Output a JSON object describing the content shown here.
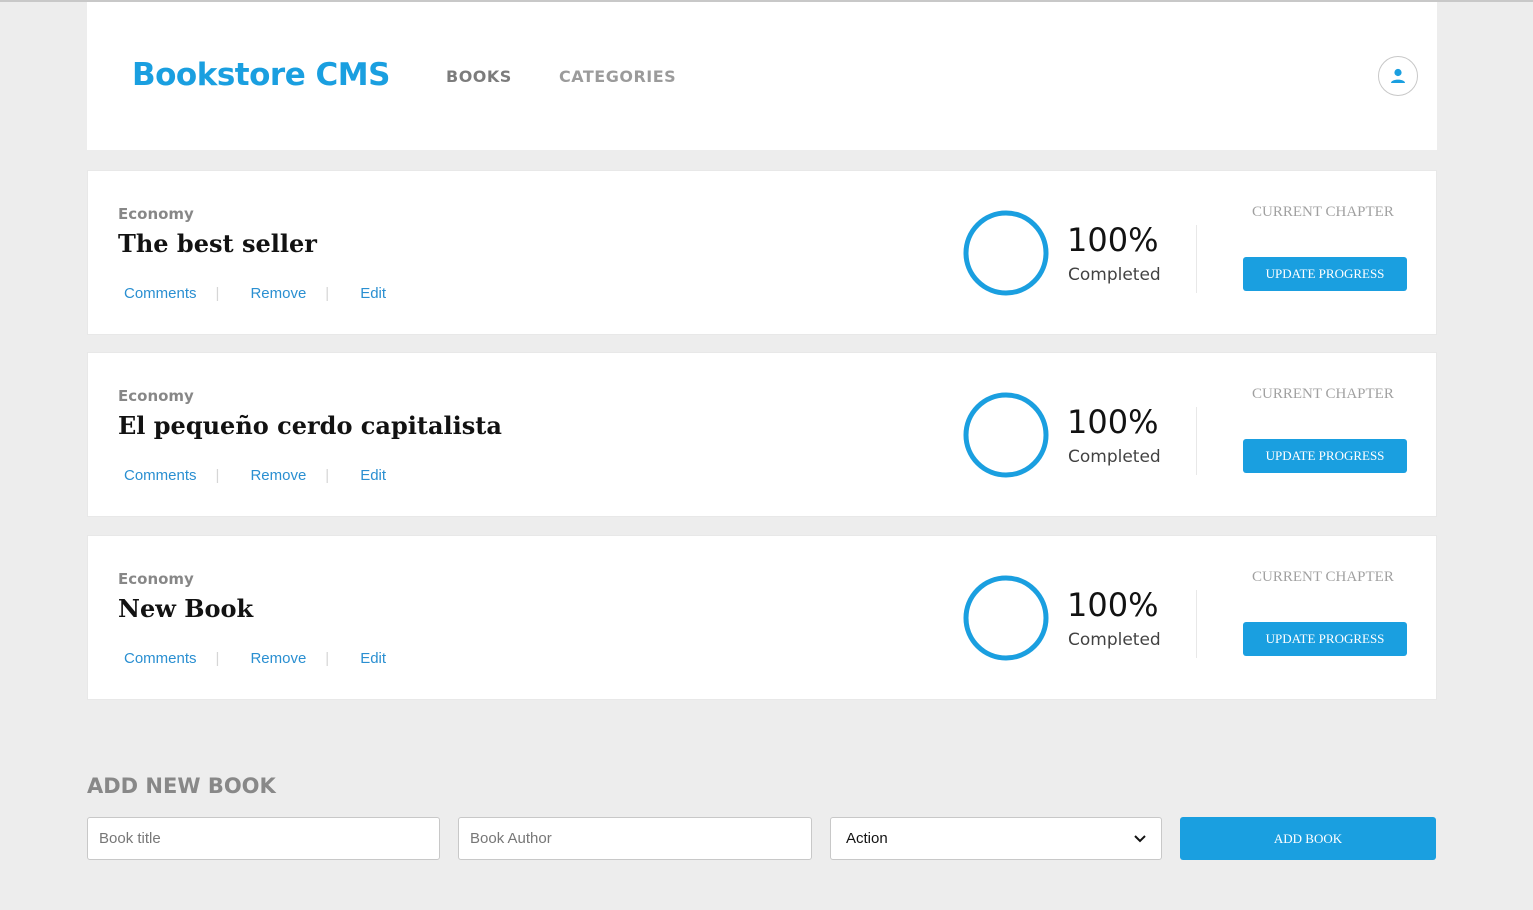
{
  "header": {
    "brand": "Bookstore CMS",
    "nav": [
      {
        "label": "BOOKS"
      },
      {
        "label": "CATEGORIES"
      }
    ],
    "avatar_icon": "user-icon"
  },
  "books": [
    {
      "category": "Economy",
      "title": "The best seller",
      "actions": {
        "comments": "Comments",
        "remove": "Remove",
        "edit": "Edit"
      },
      "percent_label": "100%",
      "progress": 1.0,
      "completed_label": "Completed",
      "chapter_label": "CURRENT CHAPTER",
      "update_label": "UPDATE PROGRESS"
    },
    {
      "category": "Economy",
      "title": "El pequeño cerdo capitalista",
      "actions": {
        "comments": "Comments",
        "remove": "Remove",
        "edit": "Edit"
      },
      "percent_label": "100%",
      "progress": 1.0,
      "completed_label": "Completed",
      "chapter_label": "CURRENT CHAPTER",
      "update_label": "UPDATE PROGRESS"
    },
    {
      "category": "Economy",
      "title": "New Book",
      "actions": {
        "comments": "Comments",
        "remove": "Remove",
        "edit": "Edit"
      },
      "percent_label": "100%",
      "progress": 1.0,
      "completed_label": "Completed",
      "chapter_label": "CURRENT CHAPTER",
      "update_label": "UPDATE PROGRESS"
    }
  ],
  "form": {
    "heading": "ADD NEW BOOK",
    "title_placeholder": "Book title",
    "author_placeholder": "Book Author",
    "select_value": "Action",
    "submit_label": "ADD BOOK"
  },
  "colors": {
    "accent": "#1a9fe0",
    "background": "#ededed",
    "card": "#ffffff"
  }
}
